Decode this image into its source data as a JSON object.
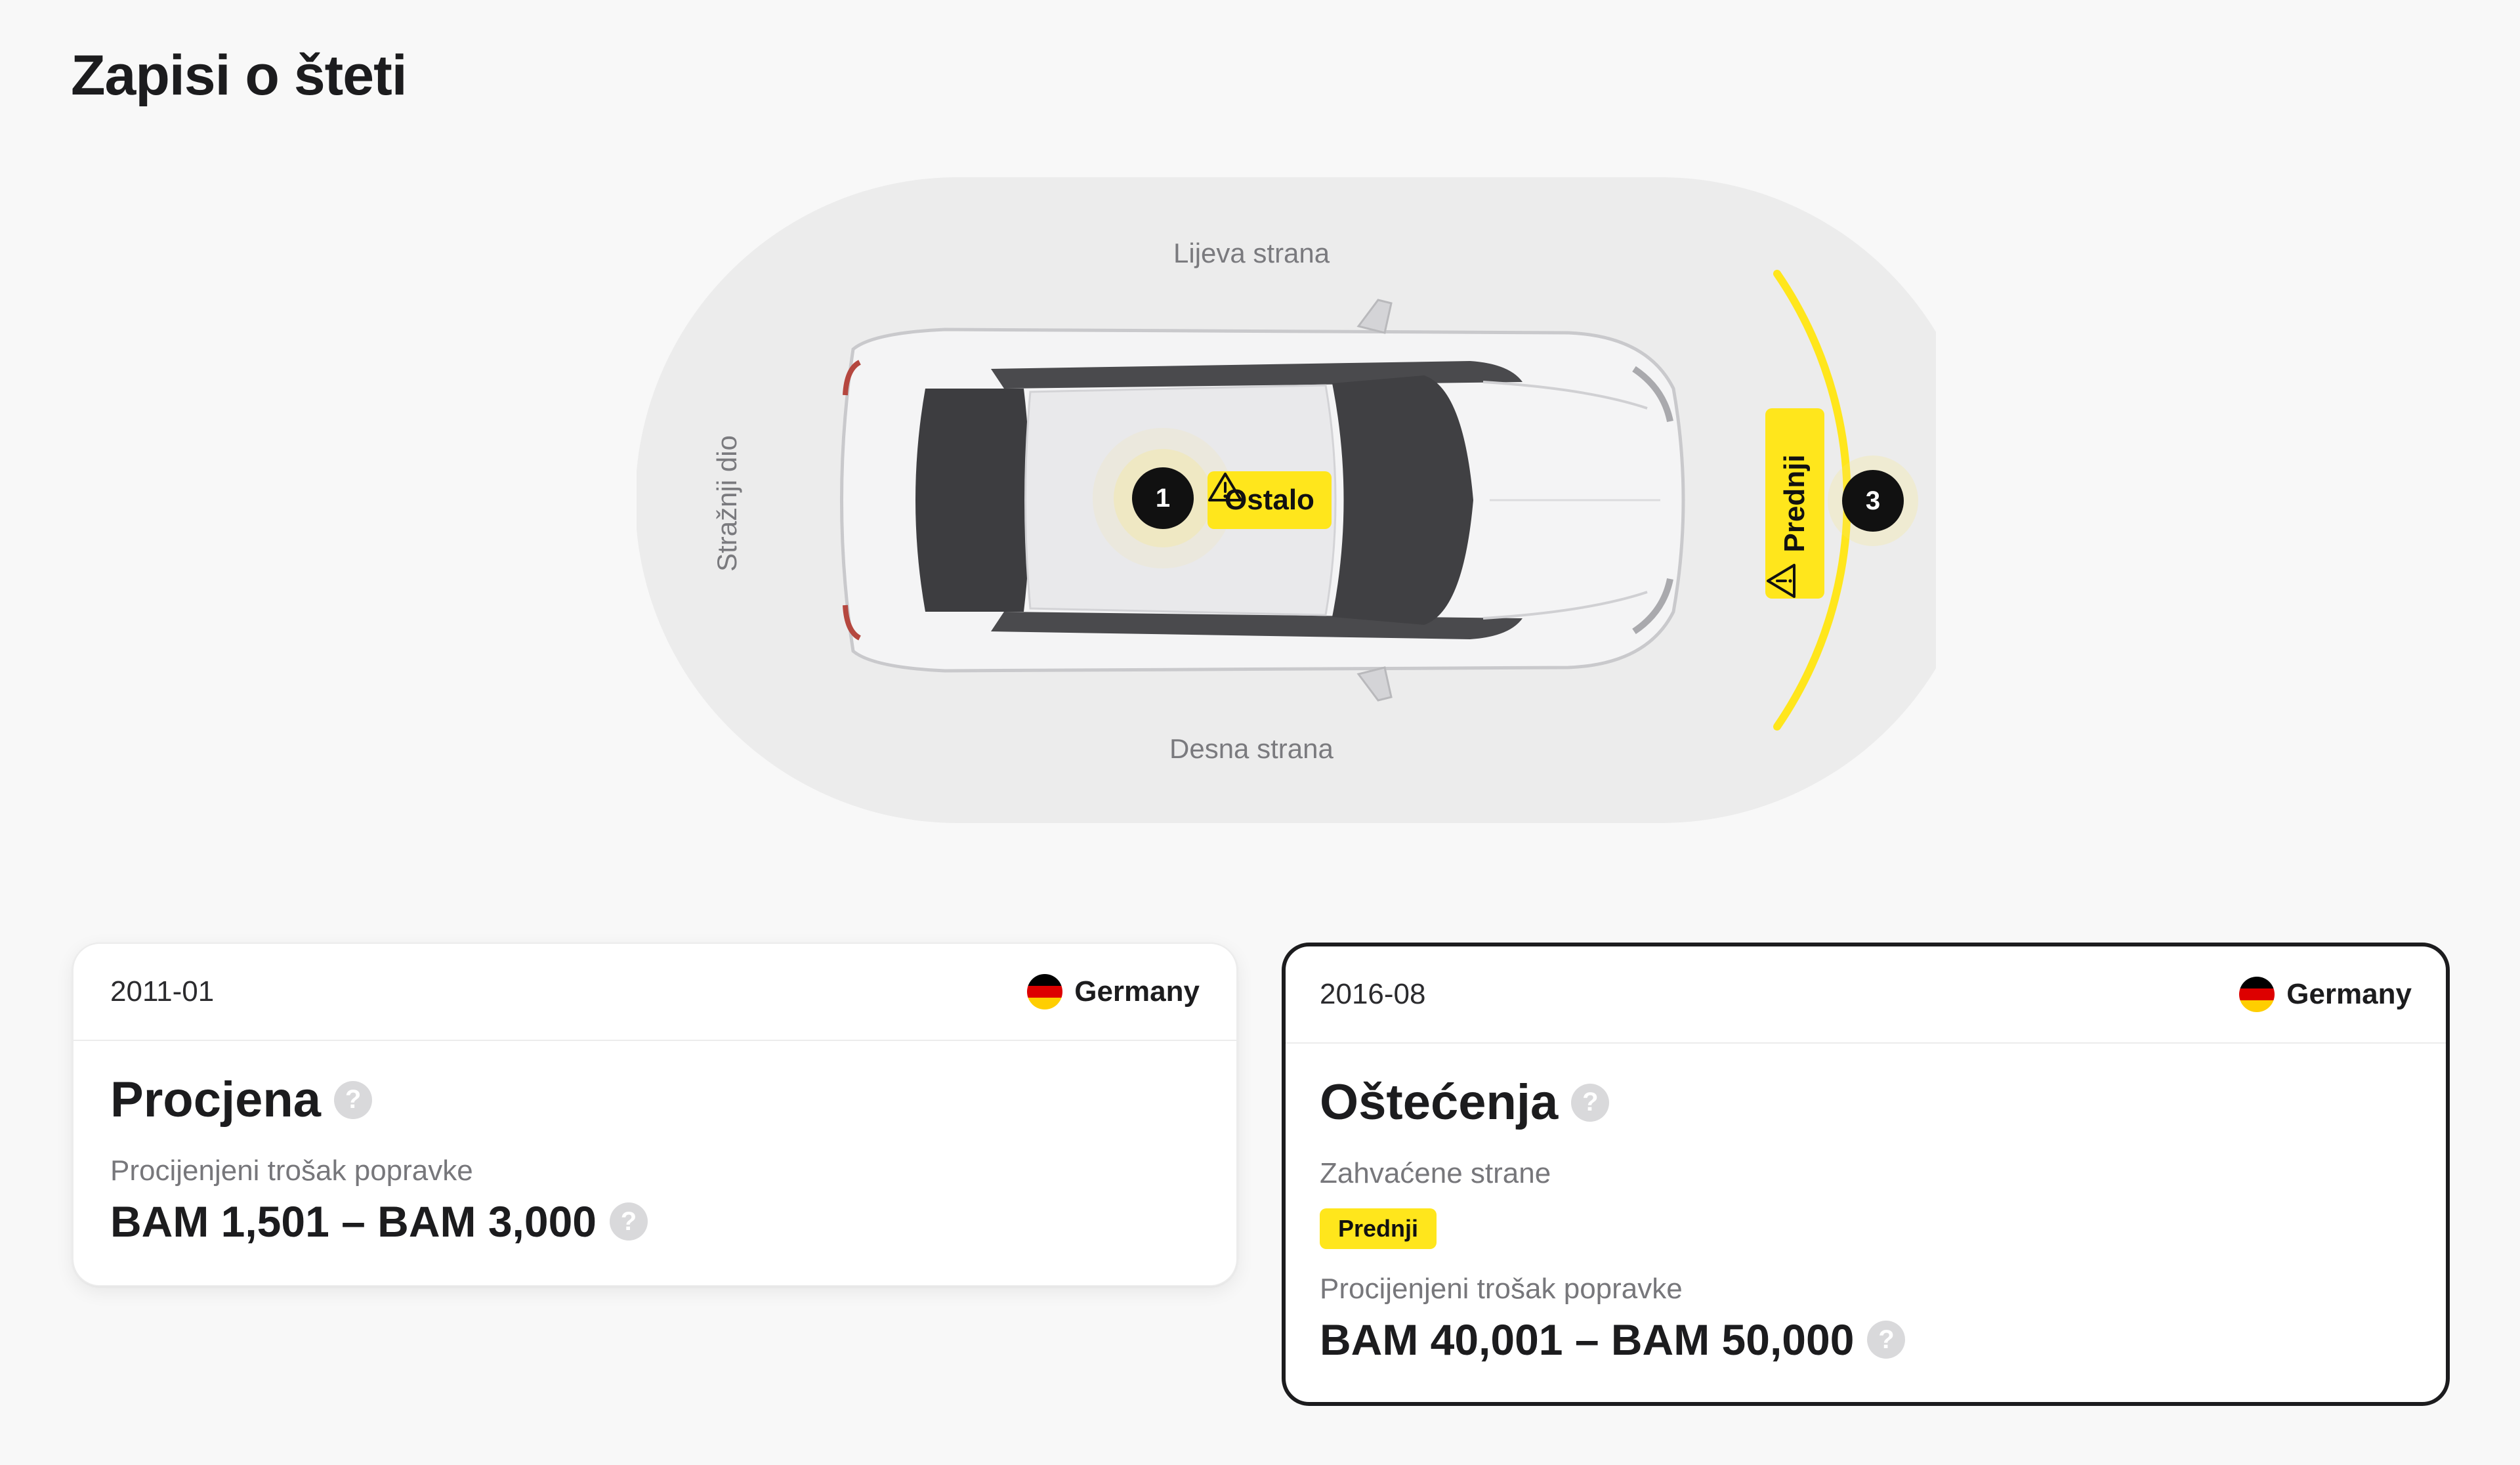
{
  "page": {
    "title": "Zapisi o šteti"
  },
  "diagram": {
    "left_side": "Lijeva strana",
    "right_side": "Desna strana",
    "rear": "Stražnji dio",
    "markers": [
      {
        "number": "1",
        "label": "Ostalo"
      },
      {
        "number": "3",
        "label": "Prednji"
      }
    ],
    "highlight_color": "#FFE61C"
  },
  "records": [
    {
      "date": "2011-01",
      "country": "Germany",
      "title": "Procjena",
      "cost_label": "Procijenjeni trošak popravke",
      "cost_range": "BAM 1,501 – BAM 3,000"
    },
    {
      "date": "2016-08",
      "country": "Germany",
      "title": "Oštećenja",
      "affected_label": "Zahvaćene strane",
      "affected_sides": [
        "Prednji"
      ],
      "cost_label": "Procijenjeni trošak popravke",
      "cost_range": "BAM 40,001 – BAM 50,000"
    }
  ],
  "icons": [
    "help-icon",
    "warning-icon",
    "germany-flag-icon"
  ]
}
